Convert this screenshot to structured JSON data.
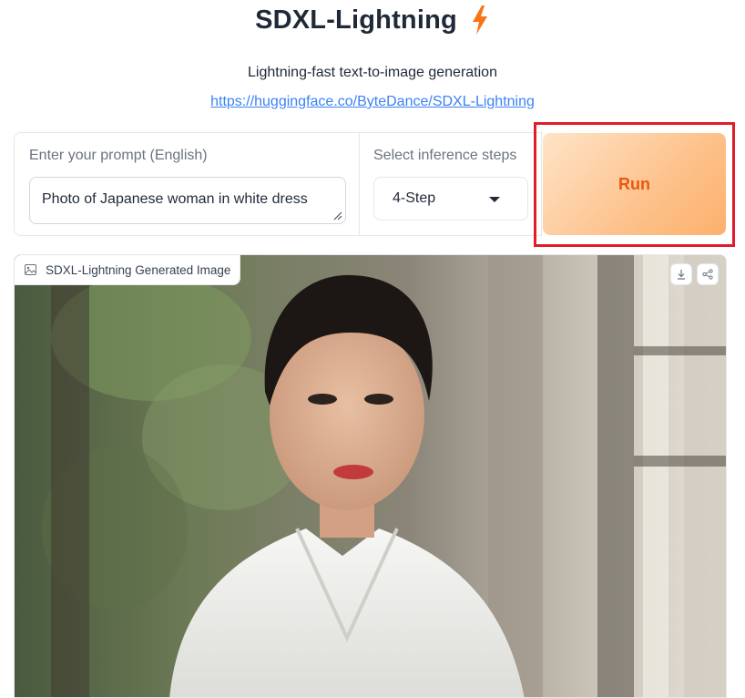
{
  "header": {
    "title": "SDXL-Lightning",
    "subtitle": "Lightning-fast text-to-image generation",
    "link": "https://huggingface.co/ByteDance/SDXL-Lightning"
  },
  "prompt": {
    "label": "Enter your prompt (English)",
    "value": "Photo of Japanese woman in white dress"
  },
  "steps": {
    "label": "Select inference steps",
    "selected": "4-Step"
  },
  "run_button": {
    "label": "Run"
  },
  "output": {
    "label": "SDXL-Lightning Generated Image"
  },
  "icons": {
    "title_icon": "lightning-bolt-icon",
    "image_label_icon": "image-icon",
    "download": "download-icon",
    "share": "share-icon"
  },
  "colors": {
    "accent": "#f97316",
    "run_text": "#ea580c",
    "link": "#3b82f6",
    "highlight": "#e11d2a"
  }
}
